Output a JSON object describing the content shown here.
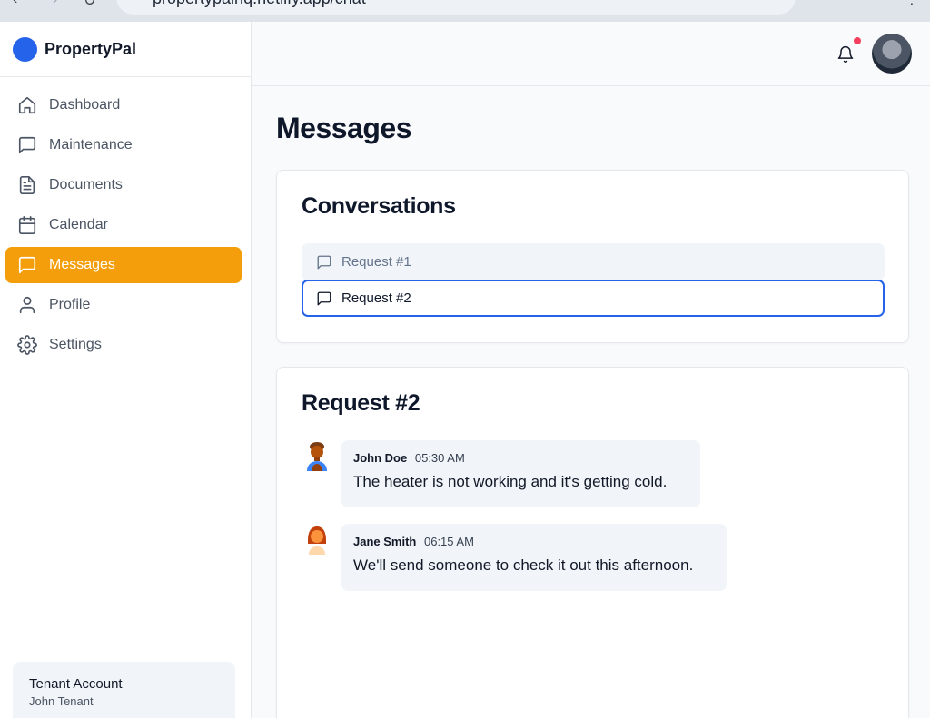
{
  "browser": {
    "url": "propertypalhq.netlify.app/chat",
    "back_glyph": "‹",
    "forward_glyph": "›",
    "reload_glyph": "↻",
    "menu_glyph": "⋮"
  },
  "brand": {
    "name": "PropertyPal",
    "logo_color": "#2563eb"
  },
  "sidebar": {
    "items": [
      {
        "label": "Dashboard",
        "icon": "home-icon",
        "active": false
      },
      {
        "label": "Maintenance",
        "icon": "message-square-icon",
        "active": false
      },
      {
        "label": "Documents",
        "icon": "file-text-icon",
        "active": false
      },
      {
        "label": "Calendar",
        "icon": "calendar-icon",
        "active": false
      },
      {
        "label": "Messages",
        "icon": "message-square-icon",
        "active": true
      },
      {
        "label": "Profile",
        "icon": "user-icon",
        "active": false
      },
      {
        "label": "Settings",
        "icon": "gear-icon",
        "active": false
      }
    ],
    "active_color": "#f59e0b"
  },
  "account": {
    "title": "Tenant Account",
    "name": "John Tenant"
  },
  "header": {
    "has_notification": true,
    "notification_dot_color": "#f43f5e"
  },
  "main": {
    "title": "Messages",
    "conversations": {
      "title": "Conversations",
      "items": [
        {
          "label": "Request #1",
          "selected": false
        },
        {
          "label": "Request #2",
          "selected": true
        }
      ]
    },
    "chat": {
      "title": "Request #2",
      "messages": [
        {
          "author": "John Doe",
          "time": "05:30 AM",
          "text": "The heater is not working and it's getting cold."
        },
        {
          "author": "Jane Smith",
          "time": "06:15 AM",
          "text": "We'll send someone to check it out this afternoon."
        }
      ]
    }
  }
}
